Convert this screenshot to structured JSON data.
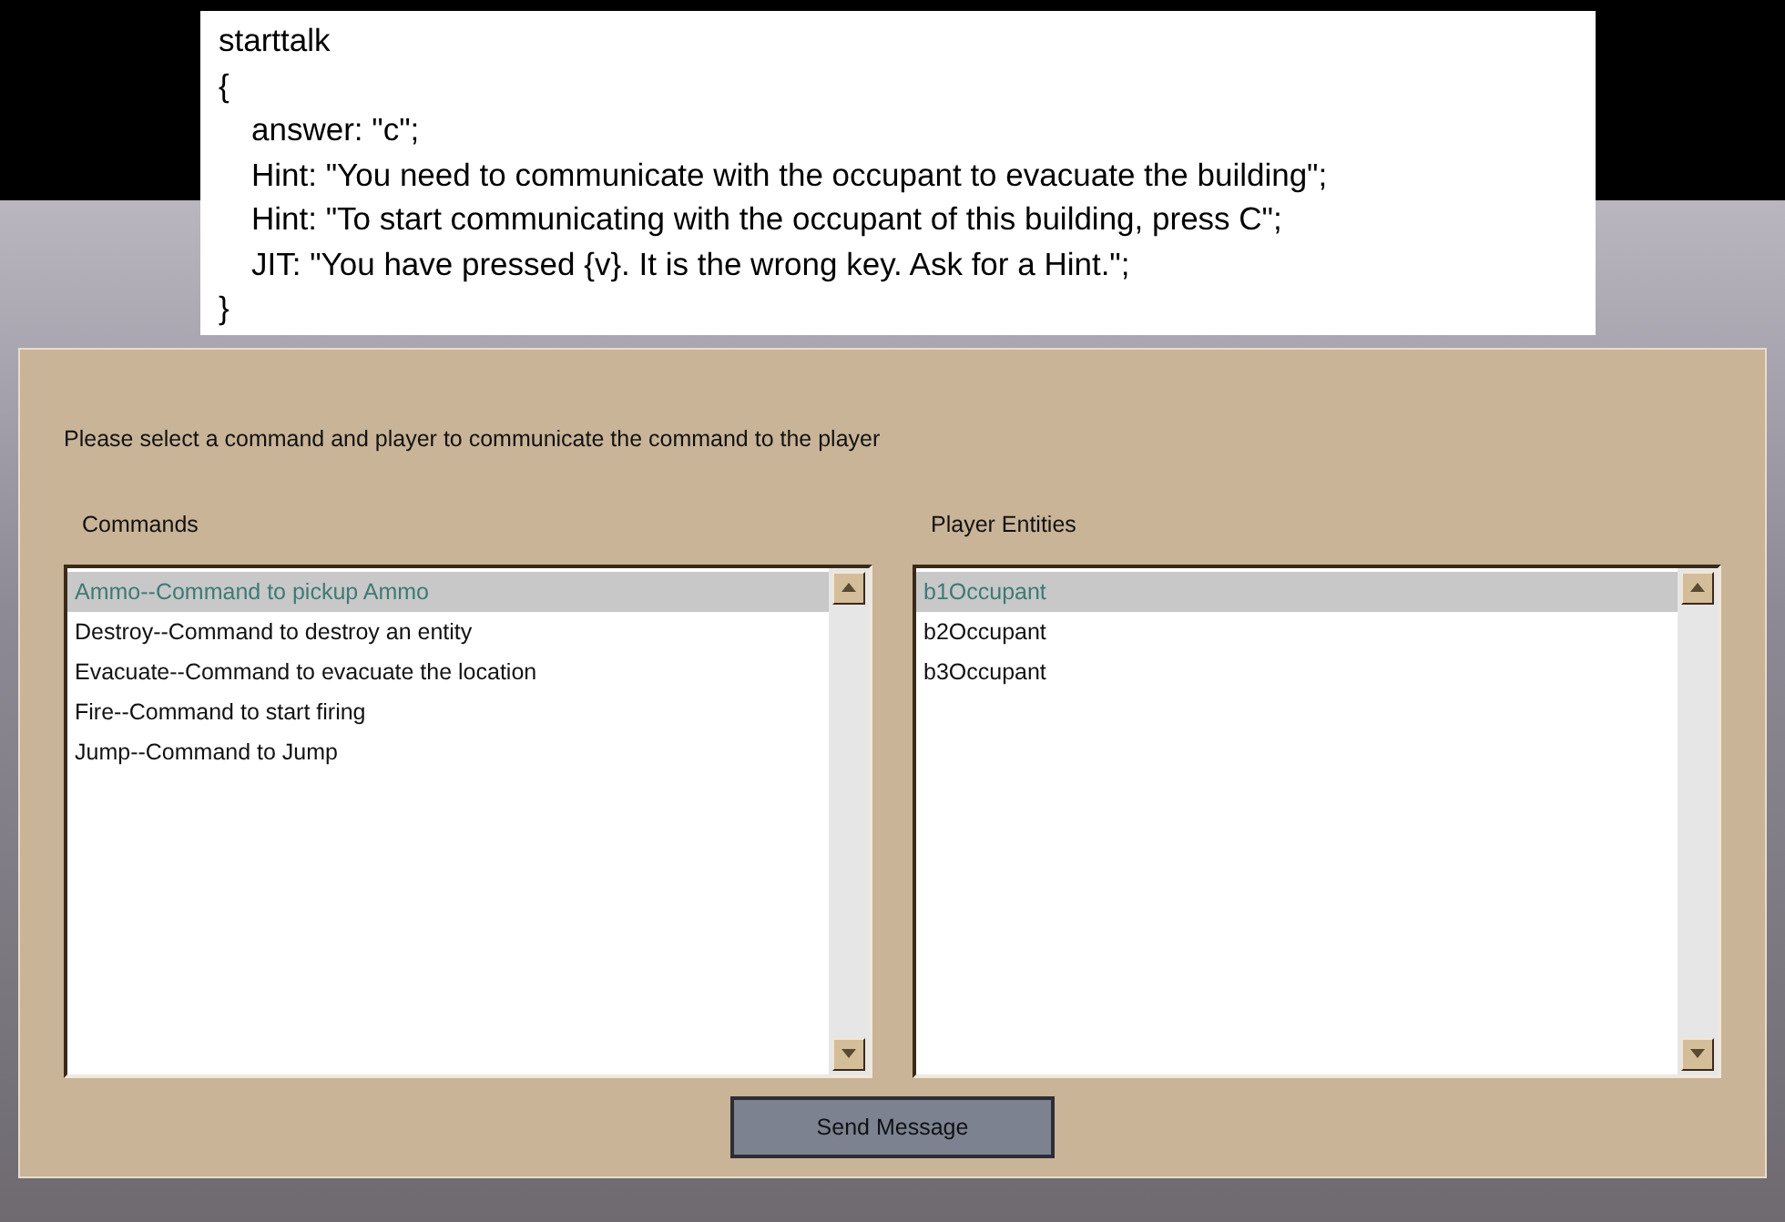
{
  "code_panel": {
    "head": [
      "starttalk",
      "{"
    ],
    "body": [
      "answer: \"c\";",
      "Hint: \"You need to communicate with the occupant to evacuate the building\";",
      "Hint: \"To start communicating with the occupant of this building, press C\";",
      "JIT: \"You have pressed {v}. It is the wrong key. Ask for a Hint.\";"
    ],
    "tail": "}"
  },
  "dialog": {
    "prompt": "Please select a command and player to communicate the command to the player",
    "commands": {
      "label": "Commands",
      "items": [
        {
          "text": "Ammo--Command to pickup Ammo",
          "selected": true
        },
        {
          "text": "Destroy--Command to destroy an entity",
          "selected": false
        },
        {
          "text": "Evacuate--Command to evacuate the location",
          "selected": false
        },
        {
          "text": "Fire--Command to start firing",
          "selected": false
        },
        {
          "text": "Jump--Command to Jump",
          "selected": false
        }
      ]
    },
    "players": {
      "label": "Player Entities",
      "items": [
        {
          "text": "b1Occupant",
          "selected": true
        },
        {
          "text": "b2Occupant",
          "selected": false
        },
        {
          "text": "b3Occupant",
          "selected": false
        }
      ]
    },
    "send_button": "Send Message"
  }
}
